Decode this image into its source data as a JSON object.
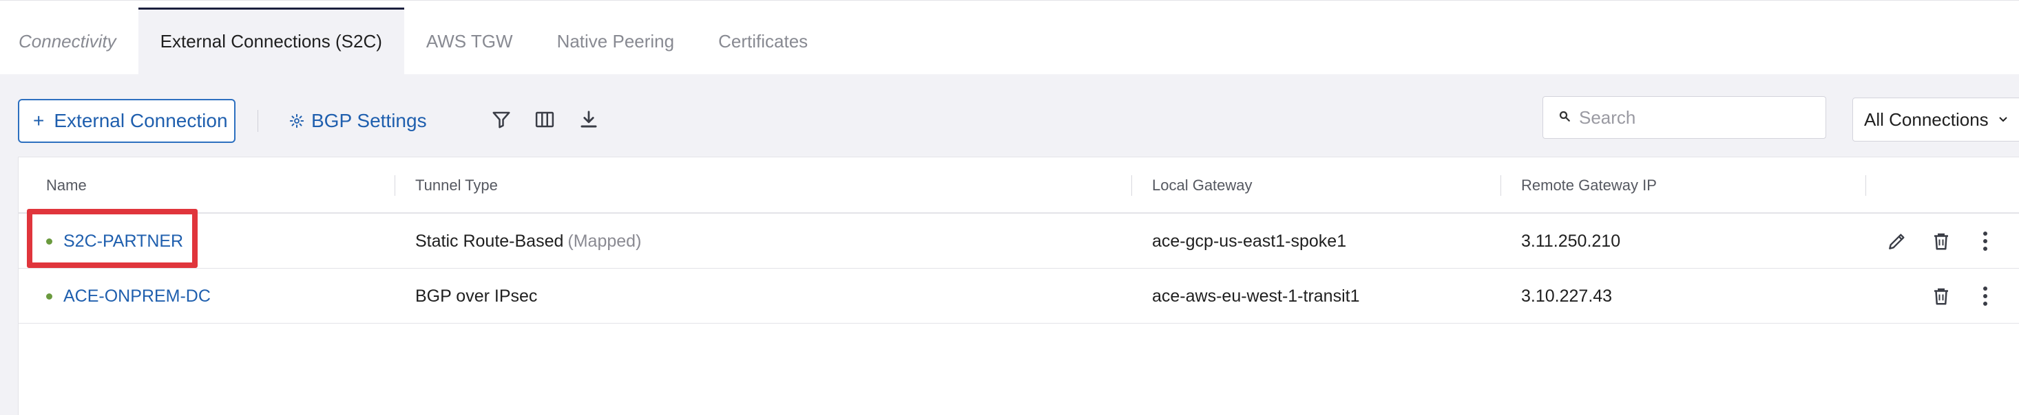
{
  "tabs": [
    {
      "label": "Connectivity",
      "active": false
    },
    {
      "label": "External Connections (S2C)",
      "active": true
    },
    {
      "label": "AWS TGW",
      "active": false
    },
    {
      "label": "Native Peering",
      "active": false
    },
    {
      "label": "Certificates",
      "active": false
    }
  ],
  "toolbar": {
    "add_label": "External Connection",
    "add_icon": "plus-icon",
    "bgp_label": "BGP Settings",
    "bgp_icon": "gear-icon",
    "icons": [
      "filter-icon",
      "columns-icon",
      "download-icon"
    ]
  },
  "search": {
    "placeholder": "Search",
    "value": ""
  },
  "filter_select": {
    "value": "All Connections"
  },
  "table": {
    "columns": [
      "Name",
      "Tunnel Type",
      "Local Gateway",
      "Remote Gateway IP"
    ],
    "rows": [
      {
        "name": "S2C-PARTNER",
        "status": "up",
        "tunnel_type": "Static Route-Based",
        "tunnel_note": "(Mapped)",
        "local_gateway": "ace-gcp-us-east1-spoke1",
        "remote_ip": "3.11.250.210",
        "actions": [
          "edit-icon",
          "trash-icon",
          "more-icon"
        ]
      },
      {
        "name": "ACE-ONPREM-DC",
        "status": "up",
        "tunnel_type": "BGP over IPsec",
        "tunnel_note": "",
        "local_gateway": "ace-aws-eu-west-1-transit1",
        "remote_ip": "3.10.227.43",
        "actions": [
          "trash-icon",
          "more-icon"
        ]
      }
    ]
  },
  "colors": {
    "accent": "#1f5fae",
    "status_up": "#6a9a3e",
    "highlight": "#e0353c",
    "active_tab_border": "#1a1f3d"
  }
}
